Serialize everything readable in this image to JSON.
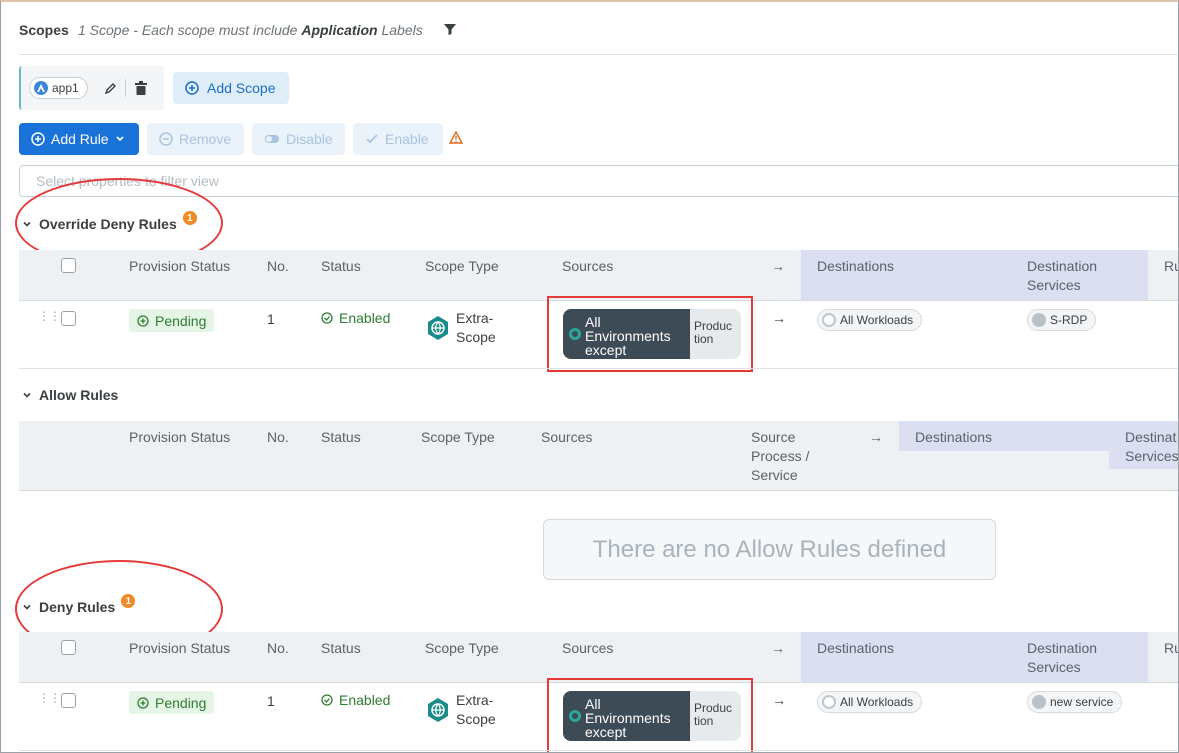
{
  "scopes": {
    "title": "Scopes",
    "desc_prefix": "1 Scope - Each scope must include ",
    "desc_bold": "Application",
    "desc_suffix": " Labels",
    "chip_label": "app1",
    "add_scope_label": "Add Scope"
  },
  "toolbar": {
    "add_rule": "Add Rule",
    "remove": "Remove",
    "disable": "Disable",
    "enable": "Enable"
  },
  "filter": {
    "placeholder": "Select properties to filter view"
  },
  "columns": {
    "provision_status": "Provision Status",
    "no": "No.",
    "status": "Status",
    "scope_type": "Scope Type",
    "sources": "Sources",
    "arrow": "→",
    "destinations": "Destinations",
    "dest_services_1": "Destination",
    "dest_services_2": "Services",
    "ru": "Ru",
    "src_proc_1": "Source",
    "src_proc_2": "Process /",
    "src_proc_3": "Service",
    "destinat": "Destinat",
    "services": "Services"
  },
  "override_deny": {
    "title": "Override Deny Rules",
    "badge": "1",
    "row": {
      "provision": "Pending",
      "no": "1",
      "status": "Enabled",
      "scope_type_1": "Extra-",
      "scope_type_2": "Scope",
      "src_l1": "All",
      "src_l2": "Environments",
      "src_l3": "except",
      "src_ex_1": "Produc",
      "src_ex_2": "tion",
      "dest": "All Workloads",
      "service": "S-RDP"
    }
  },
  "allow": {
    "title": "Allow Rules",
    "empty": "There are no Allow Rules defined"
  },
  "deny": {
    "title": "Deny Rules",
    "badge": "1",
    "row": {
      "provision": "Pending",
      "no": "1",
      "status": "Enabled",
      "scope_type_1": "Extra-",
      "scope_type_2": "Scope",
      "src_l1": "All",
      "src_l2": "Environments",
      "src_l3": "except",
      "src_ex_1": "Produc",
      "src_ex_2": "tion",
      "dest": "All Workloads",
      "service": "new service"
    }
  },
  "colors": {
    "primary": "#1a73d9",
    "annotation_red": "#e53a3a",
    "pending_green": "#2e7d32",
    "badge_orange": "#f08a24"
  },
  "icons": [
    "filter-icon",
    "app-label-icon",
    "edit-icon",
    "trash-icon",
    "plus-circle-icon",
    "chevron-down-icon",
    "minus-circle-icon",
    "toggle-icon",
    "check-icon",
    "warning-icon",
    "globe-icon",
    "environment-icon",
    "workload-icon",
    "service-icon",
    "drag-handle-icon"
  ]
}
